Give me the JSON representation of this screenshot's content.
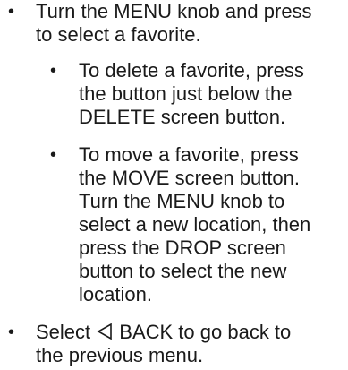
{
  "bullet_glyph": "•",
  "items": [
    {
      "lines": [
        "Turn the MENU knob and press",
        "to select a favorite."
      ]
    },
    {
      "lines": [
        "To delete a favorite, press",
        "the button just below the",
        "DELETE screen button."
      ]
    },
    {
      "lines": [
        "To move a favorite, press",
        "the MOVE screen button.",
        "Turn the MENU knob to",
        "select a new location, then",
        "press the DROP screen",
        "button to select the new",
        "location."
      ]
    },
    {
      "line1_prefix": "Select",
      "icon": "back-triangle-icon",
      "line1_suffix": "BACK to go back to",
      "line2": "the previous menu."
    }
  ]
}
